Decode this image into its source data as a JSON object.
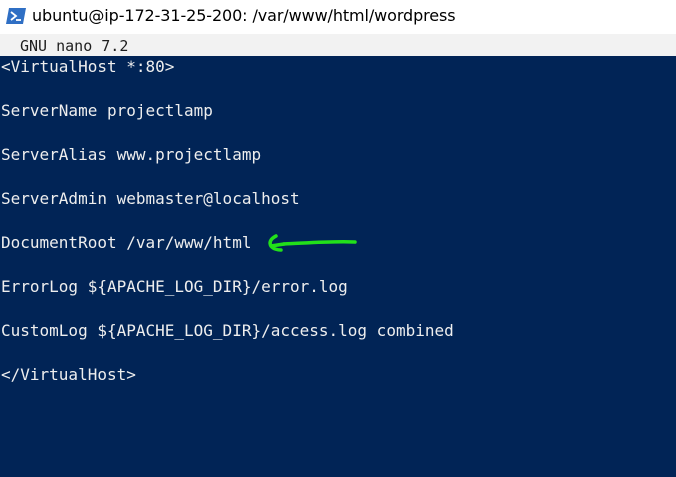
{
  "window": {
    "title": "ubuntu@ip-172-31-25-200: /var/www/html/wordpress",
    "icon": "powershell-icon"
  },
  "editor": {
    "header": "GNU nano 7.2",
    "lines": [
      "<VirtualHost *:80>",
      "ServerName projectlamp",
      "ServerAlias www.projectlamp",
      "ServerAdmin webmaster@localhost",
      "DocumentRoot /var/www/html",
      "ErrorLog ${APACHE_LOG_DIR}/error.log",
      "CustomLog ${APACHE_LOG_DIR}/access.log combined",
      "</VirtualHost>"
    ]
  },
  "colors": {
    "terminal_background": "#012456",
    "header_background": "#f2f2f2",
    "text": "#eeeeee",
    "annotation_arrow": "#22e01a"
  },
  "annotation": {
    "icon": "green-arrow-icon",
    "points_to_line": 5
  }
}
